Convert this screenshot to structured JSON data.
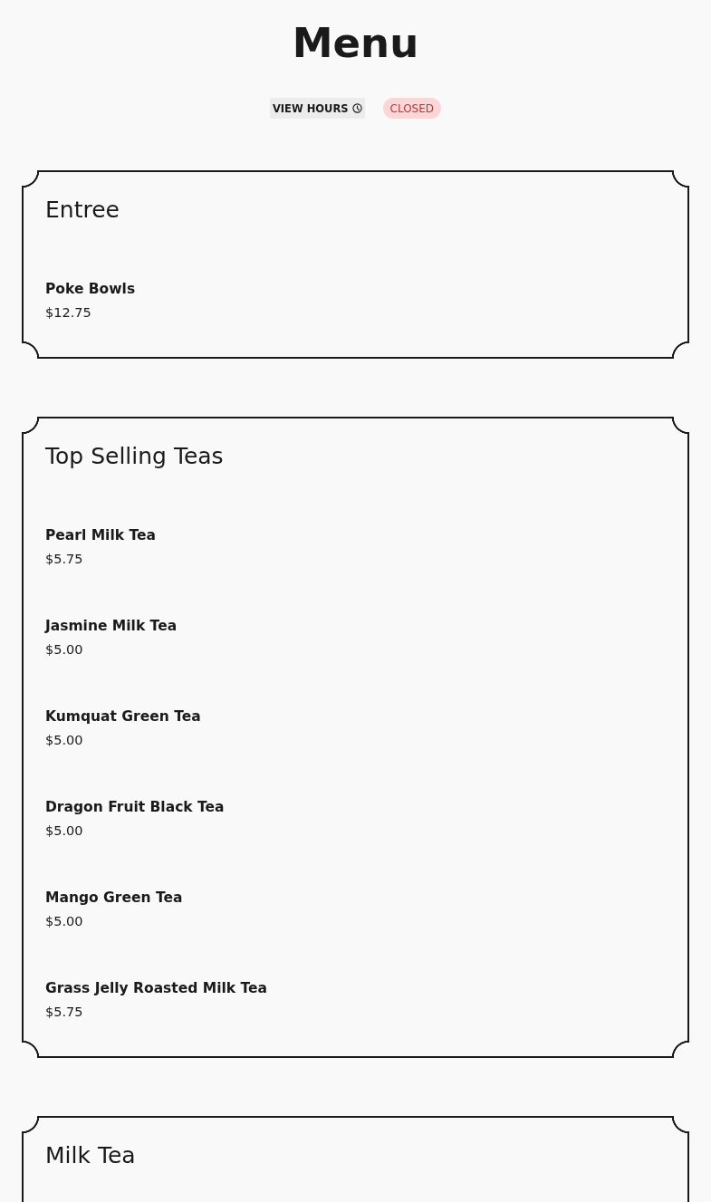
{
  "title": "Menu",
  "header": {
    "hours_button": "VIEW HOURS",
    "status": {
      "label": "CLOSED",
      "open": false
    }
  },
  "sections": [
    {
      "title": "Entree",
      "items": [
        {
          "name": "Poke Bowls",
          "price": "$12.75"
        }
      ]
    },
    {
      "title": "Top Selling Teas",
      "items": [
        {
          "name": "Pearl Milk Tea",
          "price": "$5.75"
        },
        {
          "name": "Jasmine Milk Tea",
          "price": "$5.00"
        },
        {
          "name": "Kumquat Green Tea",
          "price": "$5.00"
        },
        {
          "name": "Dragon Fruit Black Tea",
          "price": "$5.00"
        },
        {
          "name": "Mango Green Tea",
          "price": "$5.00"
        },
        {
          "name": "Grass Jelly Roasted Milk Tea",
          "price": "$5.75"
        }
      ]
    },
    {
      "title": "Milk Tea"
    }
  ]
}
